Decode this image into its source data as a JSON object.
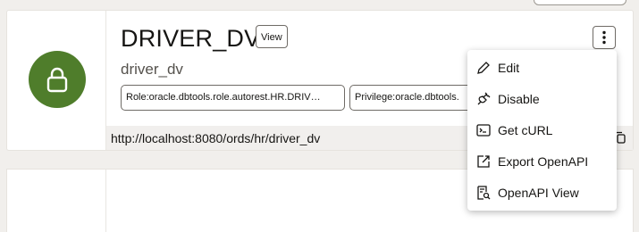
{
  "card": {
    "title": "DRIVER_DV",
    "view_label": "View",
    "subtitle": "driver_dv",
    "tags": [
      "Role:oracle.dbtools.role.autorest.HR.DRIV…",
      "Privilege:oracle.dbtools."
    ],
    "url": "http://localhost:8080/ords/hr/driver_dv",
    "avatar_color": "#4f7d2b",
    "avatar_icon": "lock-icon"
  },
  "menu": {
    "items": [
      {
        "label": "Edit",
        "icon": "pencil-icon"
      },
      {
        "label": "Disable",
        "icon": "unplug-icon"
      },
      {
        "label": "Get cURL",
        "icon": "terminal-icon"
      },
      {
        "label": "Export OpenAPI",
        "icon": "export-icon"
      },
      {
        "label": "OpenAPI View",
        "icon": "document-search-icon"
      }
    ]
  }
}
